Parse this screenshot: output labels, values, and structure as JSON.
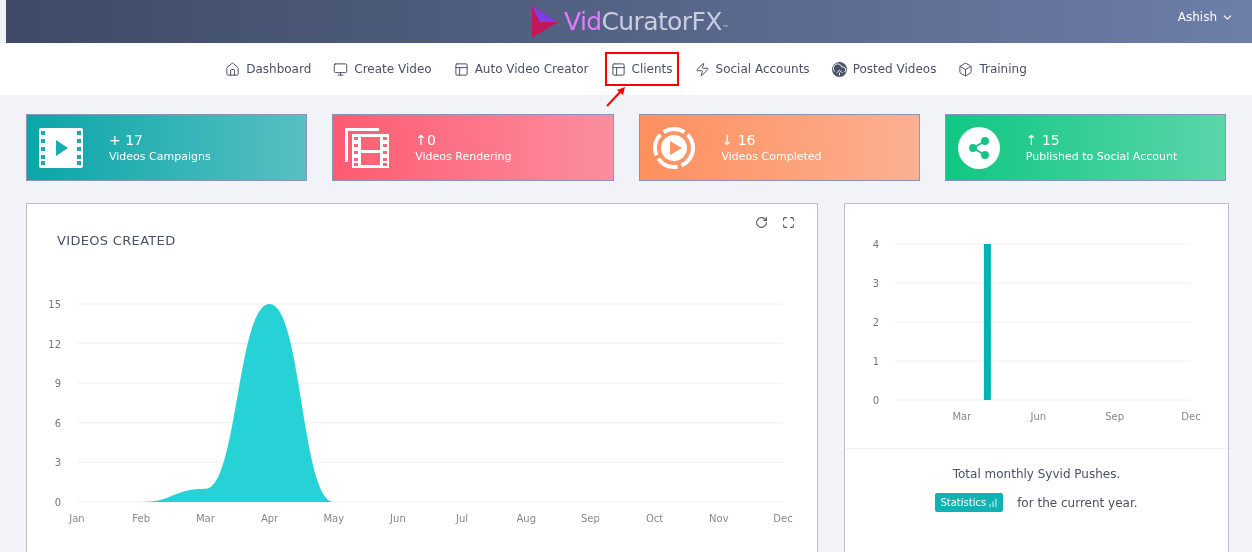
{
  "header": {
    "logo": {
      "part1": "Vid",
      "part2": "CuratorFX",
      "mark": "™"
    },
    "user": "Ashish"
  },
  "nav": [
    {
      "label": "Dashboard",
      "highlighted": false
    },
    {
      "label": "Create Video",
      "highlighted": false
    },
    {
      "label": "Auto Video Creator",
      "highlighted": false
    },
    {
      "label": "Clients",
      "highlighted": true
    },
    {
      "label": "Social Accounts",
      "highlighted": false
    },
    {
      "label": "Posted Videos",
      "highlighted": false
    },
    {
      "label": "Training",
      "highlighted": false
    }
  ],
  "stats": [
    {
      "value": "+ 17",
      "label": "Videos Campaigns",
      "color": "#0aa6a8"
    },
    {
      "value": "↑0",
      "label": "Videos Rendering",
      "color": "#ff5b72"
    },
    {
      "value": "↓ 16",
      "label": "Videos Completed",
      "color": "#ff8f5e"
    },
    {
      "value": "↑ 15",
      "label": "Published to Social Account",
      "color": "#10c783"
    }
  ],
  "videos_chart": {
    "title": "VIDEOS CREATED",
    "chart_data": {
      "type": "area",
      "categories": [
        "Jan",
        "Feb",
        "Mar",
        "Apr",
        "May",
        "Jun",
        "Jul",
        "Aug",
        "Sep",
        "Oct",
        "Nov",
        "Dec"
      ],
      "series": [
        {
          "color": "#26d2d6",
          "values": [
            null,
            0,
            1,
            15,
            0,
            null,
            null,
            null,
            null,
            null,
            null,
            null
          ]
        }
      ],
      "ylim": [
        0,
        15
      ],
      "yticks": [
        0,
        3,
        6,
        9,
        12,
        15
      ],
      "grid": true
    }
  },
  "pushes_chart": {
    "chart_data": {
      "type": "bar",
      "categories": [
        null,
        null,
        "Mar",
        null,
        null,
        "Jun",
        null,
        null,
        "Sep",
        null,
        null,
        "Dec"
      ],
      "series": [
        {
          "color": "#00b3b3",
          "values": [
            0,
            0,
            0,
            4,
            0,
            0,
            0,
            0,
            0,
            0,
            0,
            0
          ]
        }
      ],
      "ylim": [
        0,
        4
      ],
      "yticks": [
        0,
        1,
        2,
        3,
        4
      ],
      "grid": true
    },
    "caption": "Total monthly Syvid Pushes.",
    "badge": "Statistics",
    "suffix": "for the current year."
  }
}
